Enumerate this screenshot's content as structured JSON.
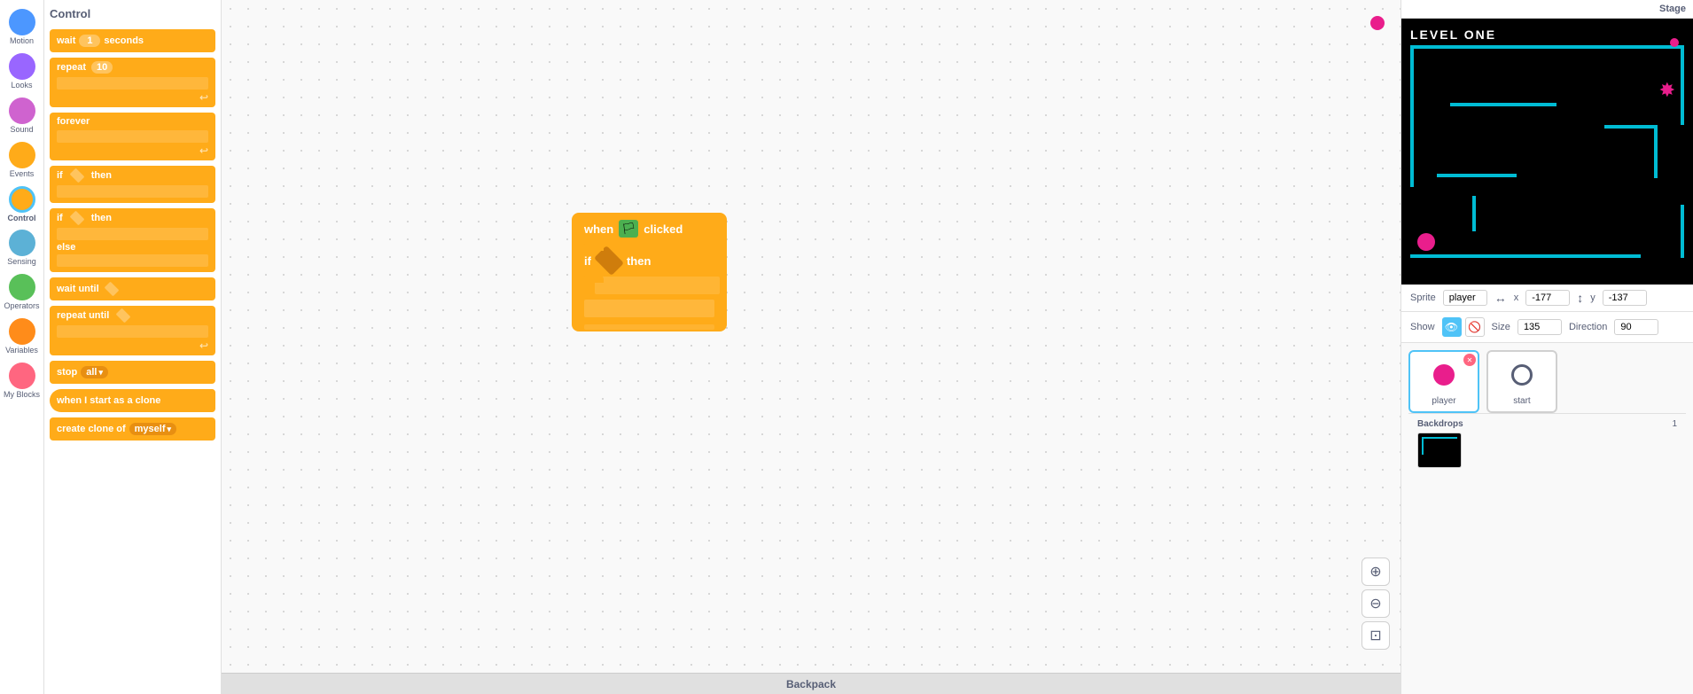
{
  "categories": [
    {
      "id": "motion",
      "label": "Motion",
      "color": "#4c97ff"
    },
    {
      "id": "looks",
      "label": "Looks",
      "color": "#9966ff"
    },
    {
      "id": "sound",
      "label": "Sound",
      "color": "#cf63cf"
    },
    {
      "id": "events",
      "label": "Events",
      "color": "#ffab19"
    },
    {
      "id": "control",
      "label": "Control",
      "color": "#ffab19",
      "active": true
    },
    {
      "id": "sensing",
      "label": "Sensing",
      "color": "#5cb1d6"
    },
    {
      "id": "operators",
      "label": "Operators",
      "color": "#59c059"
    },
    {
      "id": "variables",
      "label": "Variables",
      "color": "#ff8c1a"
    },
    {
      "id": "myblocks",
      "label": "My Blocks",
      "color": "#ff6680"
    }
  ],
  "panel": {
    "title": "Control",
    "blocks": [
      {
        "type": "wait",
        "label": "wait",
        "value": "1",
        "suffix": "seconds"
      },
      {
        "type": "repeat",
        "label": "repeat",
        "value": "10"
      },
      {
        "type": "forever",
        "label": "forever"
      },
      {
        "type": "if-then",
        "label": "if",
        "suffix": "then"
      },
      {
        "type": "if-else",
        "label": "if",
        "middle": "else",
        "suffix": "then"
      },
      {
        "type": "wait-until",
        "label": "wait until"
      },
      {
        "type": "repeat-until",
        "label": "repeat until"
      },
      {
        "type": "stop",
        "label": "stop",
        "value": "all"
      },
      {
        "type": "clone-start",
        "label": "when I start as a clone"
      },
      {
        "type": "create-clone",
        "label": "create clone of",
        "value": "myself"
      }
    ]
  },
  "canvas": {
    "blocks": [
      {
        "type": "when-clicked",
        "label_when": "when",
        "label_clicked": "clicked"
      },
      {
        "type": "if-then",
        "label_if": "if",
        "label_then": "then"
      }
    ]
  },
  "stage": {
    "title": "Stage",
    "level_label": "LEVEL ONE",
    "backdrops_label": "Backdrops",
    "backdrops_count": "1"
  },
  "sprite_info": {
    "sprite_label": "Sprite",
    "sprite_name": "player",
    "x_label": "x",
    "x_value": "-177",
    "y_label": "y",
    "y_value": "-137",
    "show_label": "Show",
    "size_label": "Size",
    "size_value": "135",
    "direction_label": "Direction",
    "direction_value": "90"
  },
  "sprites": [
    {
      "id": "player",
      "name": "player",
      "type": "dot",
      "active": true
    },
    {
      "id": "start",
      "name": "start",
      "type": "circle",
      "active": false
    }
  ],
  "toolbar": {
    "backpack_label": "Backpack"
  },
  "icons": {
    "zoom_in": "+",
    "zoom_out": "−",
    "fit": "⊡",
    "eye_open": "👁",
    "eye_closed": "🚫",
    "flag": "⚑",
    "chevron": "▾",
    "arrow_h": "↔",
    "arrow_v": "↕"
  }
}
